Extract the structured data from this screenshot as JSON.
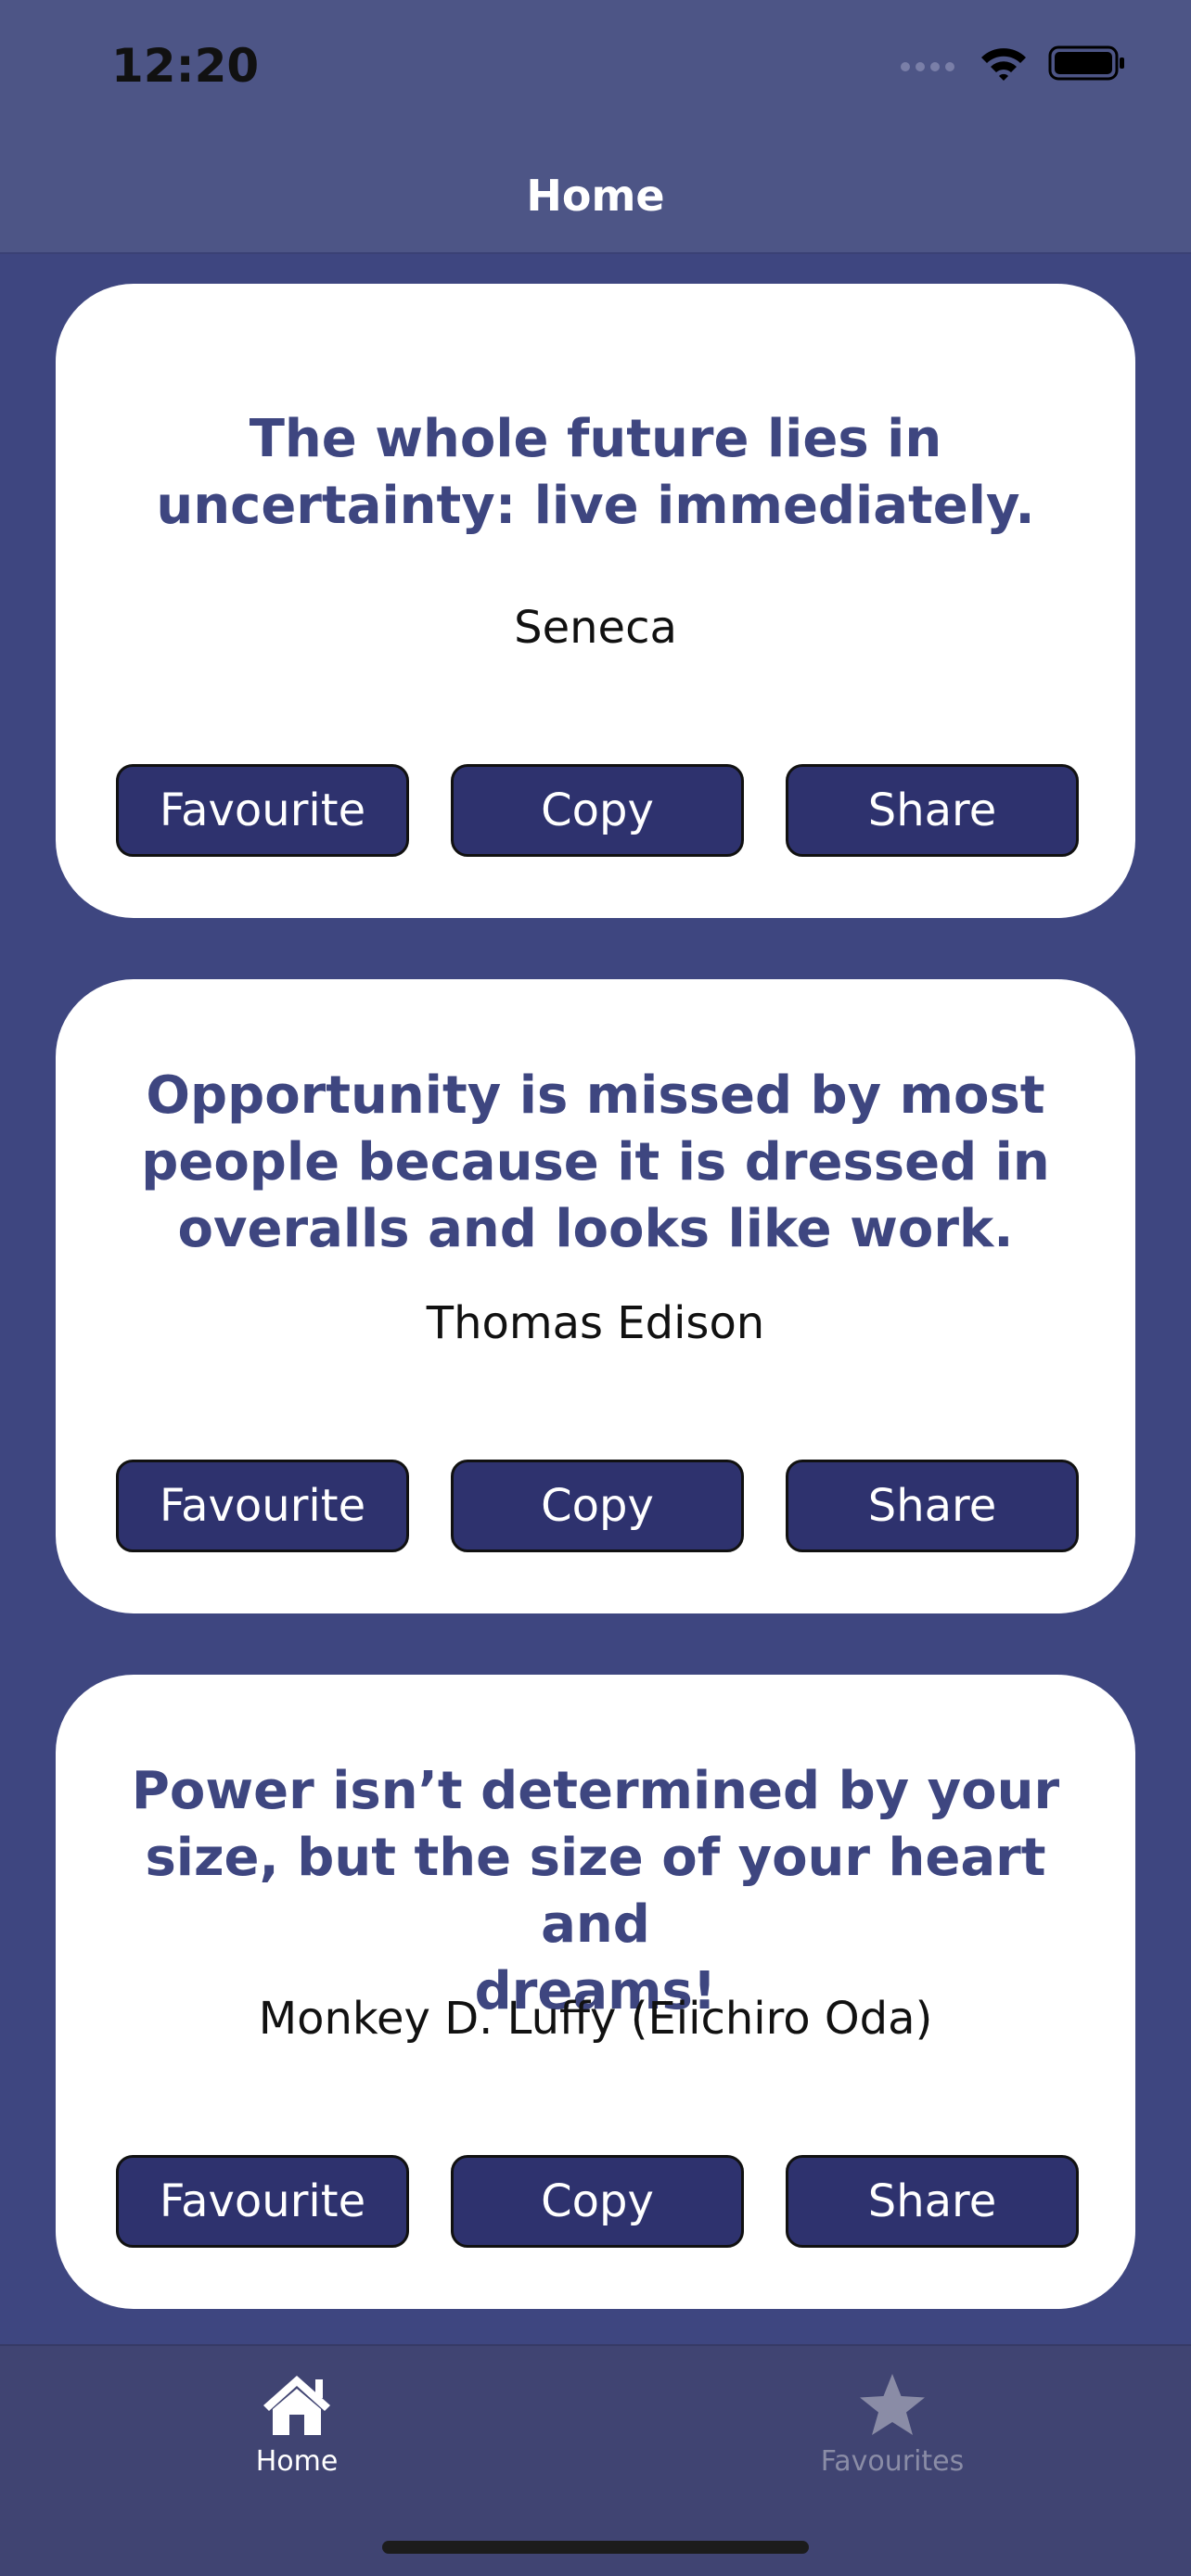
{
  "status_bar": {
    "time": "12:20"
  },
  "nav": {
    "title": "Home"
  },
  "quotes": [
    {
      "line1": "The whole future lies in",
      "line2": "uncertainty: live immediately.",
      "line3": "",
      "author": "Seneca",
      "favourite_label": "Favourite",
      "copy_label": "Copy",
      "share_label": "Share"
    },
    {
      "line1": "Opportunity is missed by most",
      "line2": "people because it is dressed in",
      "line3": "overalls and looks like work.",
      "author": "Thomas Edison",
      "favourite_label": "Favourite",
      "copy_label": "Copy",
      "share_label": "Share"
    },
    {
      "line1": "Power isn’t determined by your",
      "line2": "size, but the size of your heart and",
      "line3": "dreams!",
      "author": "Monkey D. Luffy (Eiichiro Oda)",
      "favourite_label": "Favourite",
      "copy_label": "Copy",
      "share_label": "Share"
    }
  ],
  "tab_bar": {
    "tabs": [
      {
        "label": "Home",
        "icon": "home-icon",
        "active": true,
        "color": "#ffffff"
      },
      {
        "label": "Favourites",
        "icon": "star-icon",
        "active": false,
        "color": "#8a8ca6"
      }
    ]
  },
  "colors": {
    "background": "#3e4680",
    "header": "#4d5586",
    "quote_text": "#3e4680",
    "button": "#2e326e"
  }
}
